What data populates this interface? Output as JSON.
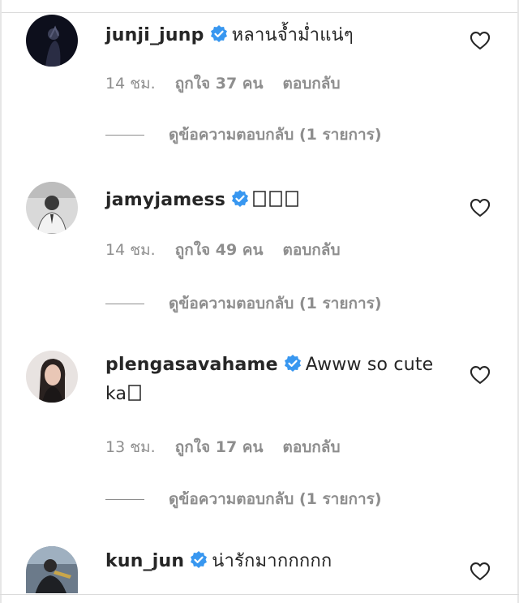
{
  "comments": [
    {
      "username": "junji_junp",
      "text": "หลานจ้ำม่ำแน่ๆ",
      "time": "14 ชม.",
      "likes": "ถูกใจ 37 คน",
      "reply_label": "ตอบกลับ",
      "view_replies": "ดูข้อความตอบกลับ (1 รายการ)"
    },
    {
      "username": "jamyjamess",
      "text": "",
      "time": "14 ชม.",
      "likes": "ถูกใจ 49 คน",
      "reply_label": "ตอบกลับ",
      "view_replies": "ดูข้อความตอบกลับ (1 รายการ)"
    },
    {
      "username": "plengasavahame",
      "text": "Awww so cute ka",
      "time": "13 ชม.",
      "likes": "ถูกใจ 17 คน",
      "reply_label": "ตอบกลับ",
      "view_replies": "ดูข้อความตอบกลับ (1 รายการ)"
    },
    {
      "username": "kun_jun",
      "text": "น่ารักมากกกกก"
    }
  ],
  "icons": {
    "verified": "verified-badge-icon",
    "like": "heart-outline-icon"
  },
  "colors": {
    "verified_blue": "#3897f0",
    "text": "#262626",
    "secondary_text": "#8e8e8e"
  }
}
